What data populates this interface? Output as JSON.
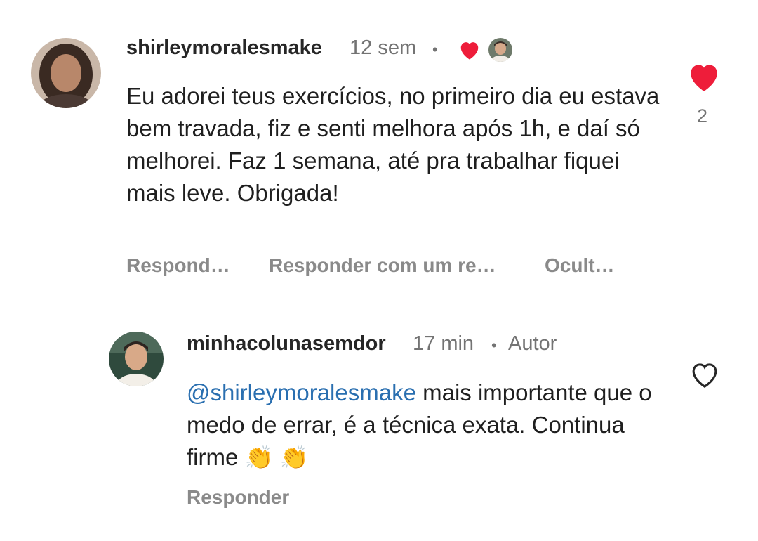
{
  "comment": {
    "username": "shirleymoralesmake",
    "time": "12 sem",
    "separator": "•",
    "text": "Eu adorei teus exercícios,  no primeiro dia eu estava bem travada, fiz e senti melhora após 1h, e daí só melhorei. Faz 1 semana, até pra trabalhar fiquei mais leve. Obrigada!",
    "like_count": "2",
    "actions": [
      "Respond…",
      "Responder com um re…",
      "Ocult…"
    ],
    "liked": true,
    "icons": [
      "creator-heart-icon",
      "liked-heart-icon"
    ]
  },
  "reply": {
    "username": "minhacolunasemdor",
    "time": "17 min",
    "separator": "•",
    "badge": "Autor",
    "mention": "@shirleymoralesmake",
    "text": " mais importante que o medo de errar, é a técnica exata. Continua firme ",
    "emoji": "👏 👏",
    "action": "Responder",
    "icons": [
      "like-heart-outline-icon"
    ]
  },
  "colors": {
    "heart_red": "#ee1d3a",
    "mention_blue": "#2a6fb0",
    "meta_gray": "#737373"
  }
}
